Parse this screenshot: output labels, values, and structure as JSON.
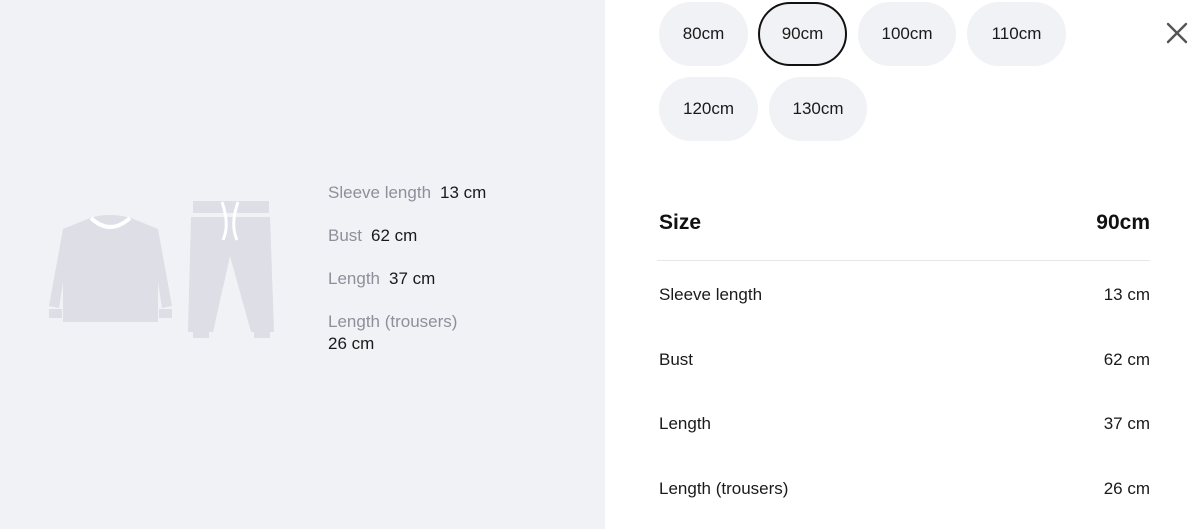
{
  "garment_measurements": [
    {
      "label": "Sleeve length",
      "value": "13 cm"
    },
    {
      "label": "Bust",
      "value": "62 cm"
    },
    {
      "label": "Length",
      "value": "37 cm"
    },
    {
      "label": "Length (trousers)",
      "value": "26 cm"
    }
  ],
  "size_options": [
    {
      "label": "80cm",
      "selected": false
    },
    {
      "label": "90cm",
      "selected": true
    },
    {
      "label": "100cm",
      "selected": false
    },
    {
      "label": "110cm",
      "selected": false
    },
    {
      "label": "120cm",
      "selected": false
    },
    {
      "label": "130cm",
      "selected": false
    }
  ],
  "size_table": {
    "header_label": "Size",
    "header_value": "90cm",
    "rows": [
      {
        "label": "Sleeve length",
        "value": "13 cm"
      },
      {
        "label": "Bust",
        "value": "62 cm"
      },
      {
        "label": "Length",
        "value": "37 cm"
      },
      {
        "label": "Length (trousers)",
        "value": "26 cm"
      }
    ]
  },
  "icons": {
    "close": "close-icon",
    "garment": "sweatshirt-and-trousers-icon"
  },
  "colors": {
    "panel_bg": "#f1f2f5",
    "label_grey": "#8e8f9b",
    "selected_border": "#111111"
  }
}
